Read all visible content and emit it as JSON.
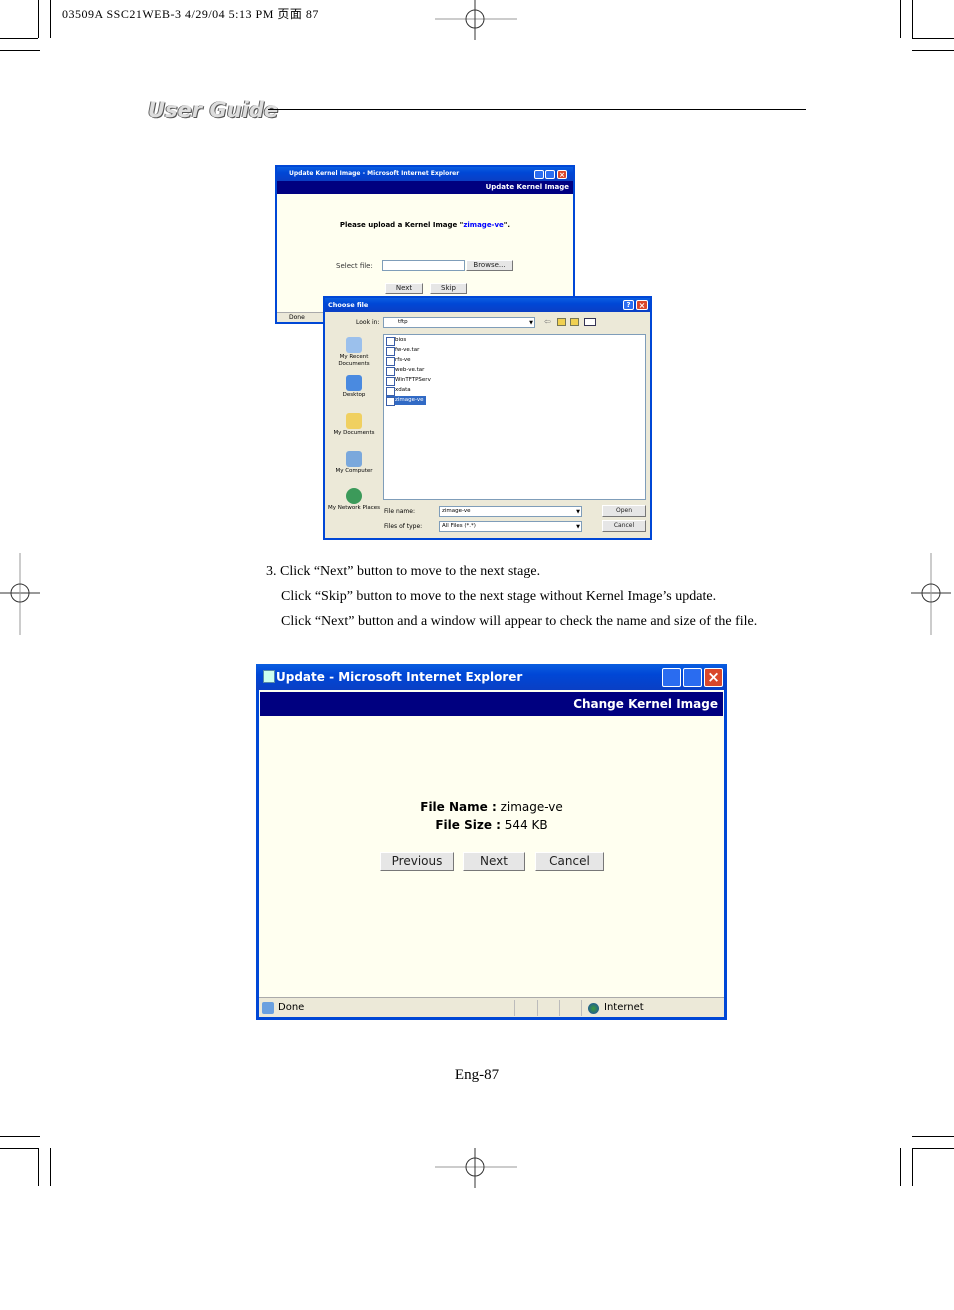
{
  "print_header": "03509A SSC21WEB-3  4/29/04  5:13 PM 页面 87",
  "section_title": "User Guide",
  "screenshot1": {
    "window_title": "Update Kernel Image - Microsoft Internet Explorer",
    "banner": "Update Kernel Image",
    "prompt": "Please upload a Kernel Image \"",
    "prompt_file": "zimage-ve",
    "prompt_end": "\".",
    "select_label": "Select file:",
    "browse": "Browse...",
    "next": "Next",
    "skip": "Skip",
    "status": "Done",
    "dialog": {
      "title": "Choose file",
      "look_in_label": "Look in:",
      "look_in_value": "tftp",
      "places": [
        "My Recent Documents",
        "Desktop",
        "My Documents",
        "My Computer",
        "My Network Places"
      ],
      "files": [
        "bios",
        "fw-ve.tar",
        "rfs-ve",
        "web-ve.tar",
        "WinTFTPServ",
        "xdata",
        "zimage-ve"
      ],
      "selected_file": "zimage-ve",
      "file_name_label": "File name:",
      "file_name_value": "zimage-ve",
      "file_type_label": "Files of type:",
      "file_type_value": "All Files (*.*)",
      "open": "Open",
      "cancel": "Cancel"
    }
  },
  "instructions": [
    "3. Click “Next” button to move to the next stage.",
    "Click “Skip” button to move to the next stage without Kernel Image’s update.",
    "Click “Next” button and a window will appear to check the name and size of the file."
  ],
  "screenshot2": {
    "window_title": "Update - Microsoft Internet Explorer",
    "banner": "Change Kernel Image",
    "file_name_label": "File Name :",
    "file_name_value": "zimage-ve",
    "file_size_label": "File Size :",
    "file_size_value": "544 KB",
    "previous": "Previous",
    "next": "Next",
    "cancel": "Cancel",
    "status": "Done",
    "zone": "Internet"
  },
  "page_number": "Eng-87",
  "colors": {
    "xp_blue": "#0047d6",
    "banner": "#000080",
    "page_bg": "#fffff0"
  }
}
